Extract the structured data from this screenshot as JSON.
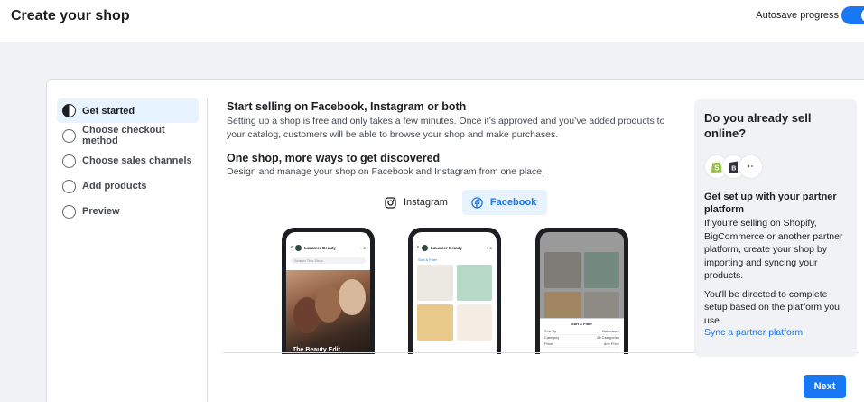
{
  "header": {
    "title": "Create your shop",
    "autosave_label": "Autosave progress",
    "autosave_on": true
  },
  "steps": [
    {
      "label": "Get started",
      "state": "active"
    },
    {
      "label": "Choose checkout method",
      "state": "todo"
    },
    {
      "label": "Choose sales channels",
      "state": "todo"
    },
    {
      "label": "Add products",
      "state": "todo"
    },
    {
      "label": "Preview",
      "state": "todo"
    }
  ],
  "main": {
    "heading": "Start selling on Facebook, Instagram or both",
    "intro": "Setting up a shop is free and only takes a few minutes. Once it’s approved and you’ve added products to your catalog, customers will be able to browse your shop and make purchases.",
    "subheading": "One shop, more ways to get discovered",
    "subtext": "Design and manage your shop on Facebook and Instagram from one place.",
    "platforms": [
      {
        "label": "Instagram",
        "icon": "instagram-icon",
        "selected": false
      },
      {
        "label": "Facebook",
        "icon": "facebook-icon",
        "selected": true
      }
    ],
    "phones": {
      "shop_name": "LaLamer Beauty",
      "search_placeholder": "Search This Shop",
      "hero_title": "The Beauty Edit",
      "sort_filter_label": "Sort & Filter",
      "sort_sheet_title": "Sort & Filter",
      "sort_rows": [
        {
          "label": "Sort By",
          "value": "Relevance"
        },
        {
          "label": "Category",
          "value": "All Categories"
        },
        {
          "label": "Price",
          "value": "Any Price"
        }
      ]
    }
  },
  "side_panel": {
    "heading": "Do you already sell online?",
    "partner_heading": "Get set up with your partner platform",
    "partner_text": "If you’re selling on Shopify, BigCommerce or another partner platform, create your shop by importing and syncing your products.",
    "redirect_text": "You'll be directed to complete setup based on the platform you use.",
    "link_label": "Sync a partner platform",
    "logos": [
      "shopify-icon",
      "bigcommerce-icon",
      "more-icon"
    ]
  },
  "footer": {
    "next_label": "Next"
  },
  "colors": {
    "accent": "#1877f2",
    "selected_bg": "#e7f3ff",
    "page_bg": "#f0f2f5"
  }
}
